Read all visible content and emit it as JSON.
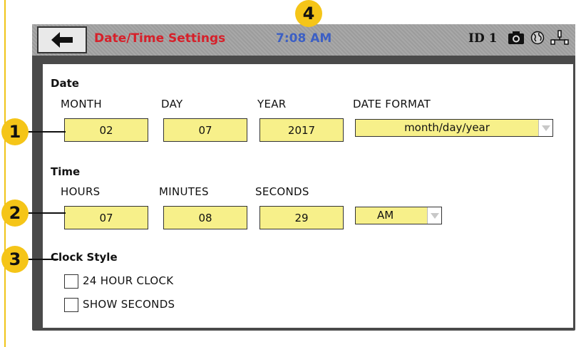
{
  "window": {
    "title": "Date/Time Settings",
    "clock": "7:08 AM",
    "device_id": "ID 1"
  },
  "icons": {
    "back": "arrow-left-icon",
    "camera": "camera-icon",
    "globe": "globe-icon",
    "network": "network-icon"
  },
  "callouts": [
    "1",
    "2",
    "3",
    "4"
  ],
  "date": {
    "heading": "Date",
    "month_label": "MONTH",
    "day_label": "DAY",
    "year_label": "YEAR",
    "format_label": "DATE FORMAT",
    "month": "02",
    "day": "07",
    "year": "2017",
    "format": "month/day/year"
  },
  "time": {
    "heading": "Time",
    "hours_label": "HOURS",
    "minutes_label": "MINUTES",
    "seconds_label": "SECONDS",
    "hours": "07",
    "minutes": "08",
    "seconds": "29",
    "meridiem": "AM"
  },
  "clock_style": {
    "heading": "Clock Style",
    "option_24h": "24 HOUR CLOCK",
    "option_seconds": "SHOW SECONDS"
  },
  "colors": {
    "title": "#d6202a",
    "clock": "#3c5fc4",
    "field_bg": "#f7f08a",
    "callout": "#f5c518"
  }
}
